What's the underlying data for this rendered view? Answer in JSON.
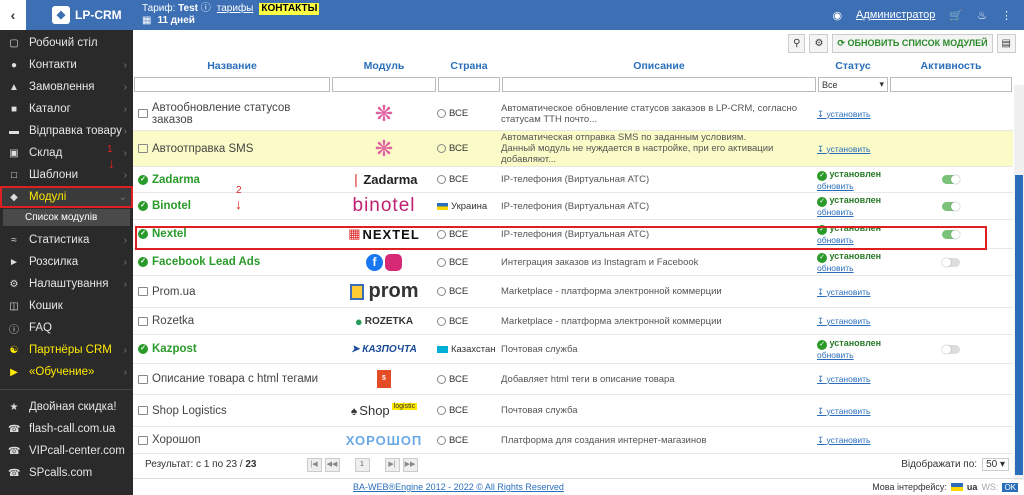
{
  "topbar": {
    "brand": "LP-CRM",
    "tariff_label": "Тариф:",
    "tariff_value": "Test",
    "tariffs_link": "тарифы",
    "contacts_link": "КОНТАКТЫ",
    "days": "11 дней",
    "user": "Администратор"
  },
  "sidebar": {
    "items": [
      {
        "label": "Робочий стіл",
        "icon": "monitor-icon"
      },
      {
        "label": "Контакти",
        "icon": "users-icon"
      },
      {
        "label": "Замовлення",
        "icon": "cart-icon"
      },
      {
        "label": "Каталог",
        "icon": "box-icon"
      },
      {
        "label": "Відправка товару",
        "icon": "truck-icon"
      },
      {
        "label": "Склад",
        "icon": "warehouse-icon"
      },
      {
        "label": "Шаблони",
        "icon": "file-icon"
      },
      {
        "label": "Модулі",
        "icon": "puzzle-icon"
      },
      {
        "label": "Список модулів",
        "icon": ""
      },
      {
        "label": "Статистика",
        "icon": "chart-icon"
      },
      {
        "label": "Розсилка",
        "icon": "megaphone-icon"
      },
      {
        "label": "Налаштування",
        "icon": "gear-icon"
      },
      {
        "label": "Кошик",
        "icon": "trash-icon"
      },
      {
        "label": "FAQ",
        "icon": "info-icon"
      },
      {
        "label": "Партнёры CRM",
        "icon": "handshake-icon"
      },
      {
        "label": "«Обучение»",
        "icon": "video-icon"
      }
    ],
    "extra": [
      {
        "label": "Двойная скидка!"
      },
      {
        "label": "flash-call.com.ua"
      },
      {
        "label": "VIPcall-center.com"
      },
      {
        "label": "SPcalls.com"
      }
    ]
  },
  "toolbar": {
    "update_label": "ОБНОВИТЬ СПИСОК МОДУЛЕЙ"
  },
  "table": {
    "headers": [
      "Название",
      "Модуль",
      "Страна",
      "Описание",
      "Статус",
      "Активность"
    ],
    "status_filter": "Все",
    "rows": [
      {
        "name": "Автообновление статусов заказов",
        "logo": "",
        "country": "ВСЕ",
        "desc1": "Автоматическое обновление статусов заказов в LP-CRM, согласно статусам ТТН почто...",
        "desc2": "",
        "installed": false,
        "active": null,
        "highlight": false
      },
      {
        "name": "Автоотправка SMS",
        "logo": "",
        "country": "ВСЕ",
        "desc1": "Автоматическая отправка SMS по заданным условиям.",
        "desc2": "Данный модуль не нуждается в настройке, при его активации добавляют...",
        "installed": false,
        "active": null,
        "highlight": true
      },
      {
        "name": "Zadarma",
        "logo": "Zadarma",
        "country": "ВСЕ",
        "desc1": "IP-телефония (Виртуальная АТС)",
        "desc2": "",
        "installed": true,
        "active": true,
        "highlight": false
      },
      {
        "name": "Binotel",
        "logo": "binotel",
        "country": "Украина",
        "desc1": "IP-телефония (Виртуальная АТС)",
        "desc2": "",
        "installed": true,
        "active": true,
        "highlight": false
      },
      {
        "name": "Nextel",
        "logo": "NEXTEL",
        "country": "ВСЕ",
        "desc1": "IP-телефония (Виртуальная АТС)",
        "desc2": "",
        "installed": true,
        "active": true,
        "highlight": false
      },
      {
        "name": "Facebook Lead Ads",
        "logo": "",
        "country": "ВСЕ",
        "desc1": "Интеграция заказов из Instagram и Facebook",
        "desc2": "",
        "installed": true,
        "active": false,
        "highlight": false
      },
      {
        "name": "Prom.ua",
        "logo": "prom",
        "country": "ВСЕ",
        "desc1": "Marketplace - платформа электронной коммерции",
        "desc2": "",
        "installed": false,
        "active": null,
        "highlight": false
      },
      {
        "name": "Rozetka",
        "logo": "ROZETKA",
        "country": "ВСЕ",
        "desc1": "Marketplace - платформа электронной коммерции",
        "desc2": "",
        "installed": false,
        "active": null,
        "highlight": false
      },
      {
        "name": "Kazpost",
        "logo": "КАЗПОЧТА",
        "country": "Казахстан",
        "desc1": "Почтовая служба",
        "desc2": "",
        "installed": true,
        "active": false,
        "highlight": false
      },
      {
        "name": "Описание товара с html тегами",
        "logo": "HTML",
        "country": "ВСЕ",
        "desc1": "Добавляет html теги в описание товара",
        "desc2": "",
        "installed": false,
        "active": null,
        "highlight": false
      },
      {
        "name": "Shop Logistics",
        "logo": "Shop",
        "logo2": "logistic",
        "country": "ВСЕ",
        "desc1": "Почтовая служба",
        "desc2": "",
        "installed": false,
        "active": null,
        "highlight": false
      },
      {
        "name": "Хорошоп",
        "logo": "ХОРОШОП",
        "country": "ВСЕ",
        "desc1": "Платформа для создания интернет-магазинов",
        "desc2": "",
        "installed": false,
        "active": null,
        "highlight": false
      }
    ],
    "installed_label": "установлен",
    "update_label": "обновить",
    "install_label": "установить"
  },
  "footer": {
    "results": "Результат: с 1 по 23 /",
    "total": "23",
    "page": "1",
    "per_page_label": "Відображати по:",
    "per_page": "50"
  },
  "bottom": {
    "copyright": "BA-WEB®Engine 2012 - 2022 © All Rights Reserved",
    "lang_label": "Мова інтерфейсу:",
    "lang": "ua",
    "ws": "WS:",
    "ws_status": "OK"
  },
  "annotations": {
    "one": "1",
    "two": "2"
  }
}
